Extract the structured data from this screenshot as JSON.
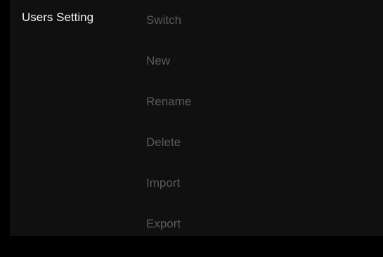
{
  "section": {
    "title": "Users Setting"
  },
  "menu": {
    "items": [
      {
        "id": "switch",
        "label": "Switch"
      },
      {
        "id": "new",
        "label": "New"
      },
      {
        "id": "rename",
        "label": "Rename"
      },
      {
        "id": "delete",
        "label": "Delete"
      },
      {
        "id": "import",
        "label": "Import"
      },
      {
        "id": "export",
        "label": "Export"
      }
    ]
  },
  "colors": {
    "background": "#000000",
    "panel": "#101010",
    "title_text": "#f2f2f2",
    "menu_text_inactive": "#5a5a5a"
  }
}
